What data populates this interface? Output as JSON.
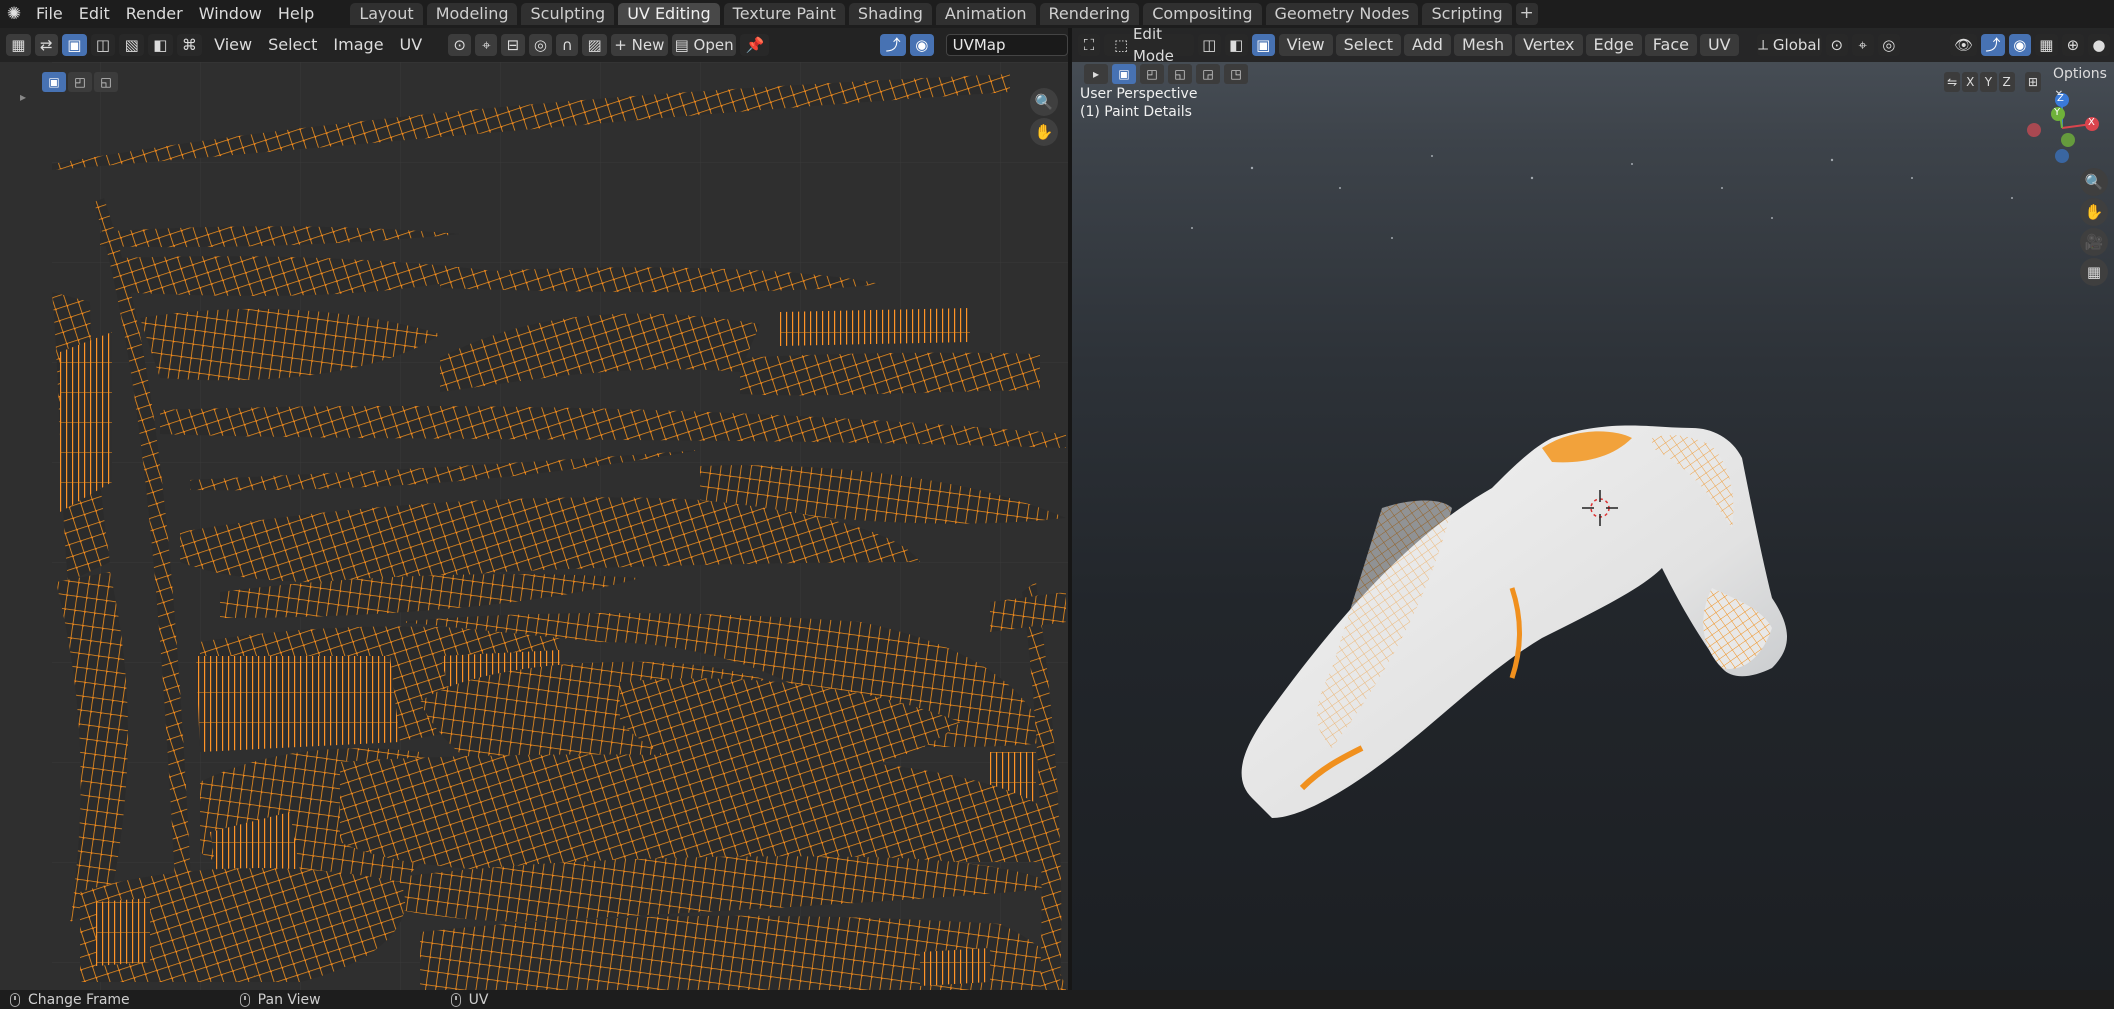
{
  "topbar": {
    "menus": [
      "File",
      "Edit",
      "Render",
      "Window",
      "Help"
    ],
    "tabs": [
      "Layout",
      "Modeling",
      "Sculpting",
      "UV Editing",
      "Texture Paint",
      "Shading",
      "Animation",
      "Rendering",
      "Compositing",
      "Geometry Nodes",
      "Scripting"
    ],
    "active_tab": "UV Editing",
    "add_tab_label": "+"
  },
  "uv_editor": {
    "menus": [
      "View",
      "Select",
      "Image",
      "UV"
    ],
    "new_label": "New",
    "open_label": "Open",
    "uv_map_name": "UVMap"
  },
  "viewport": {
    "mode": "Edit Mode",
    "menus": [
      "View",
      "Select",
      "Add",
      "Mesh",
      "Vertex",
      "Edge",
      "Face",
      "UV"
    ],
    "transform_orientation": "Global",
    "axis_toggles": [
      "X",
      "Y",
      "Z"
    ],
    "options_label": "Options",
    "overlay_view": "User Perspective",
    "overlay_object": "(1) Paint Details",
    "gizmo_labels": {
      "x": "X",
      "y": "Y",
      "z": "Z"
    }
  },
  "status_bar": {
    "items": [
      "Change Frame",
      "Pan View",
      "UV"
    ]
  },
  "colors": {
    "accent_blue": "#4772b3",
    "uv_edge": "#f0901e",
    "uv_vertex": "#ff8c1a",
    "active_tab_bg": "#484848"
  },
  "icons": [
    "blender-logo-icon",
    "editor-type-icon",
    "sync-selection-icon",
    "zoom-icon",
    "pan-hand-icon",
    "camera-icon",
    "grid-icon",
    "pin-icon"
  ]
}
